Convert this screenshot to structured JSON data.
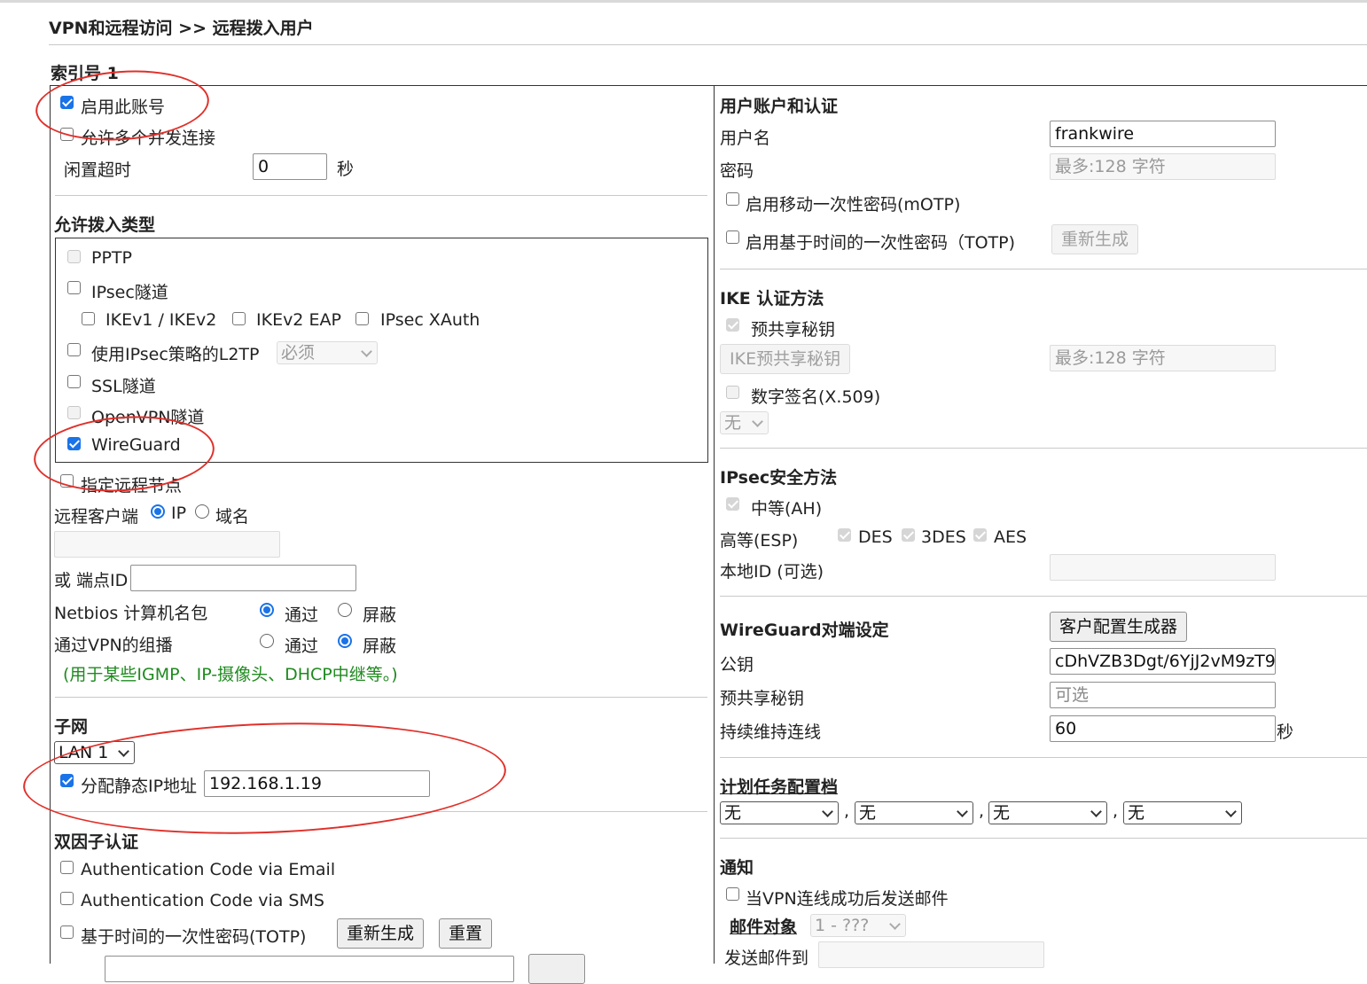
{
  "breadcrumb": "VPN和远程访问 >> 远程拨入用户",
  "index_title": "索引号 1",
  "left": {
    "enable_account": "启用此账号",
    "allow_multi": "允许多个并发连接",
    "idle_timeout_label": "闲置超时",
    "idle_timeout_value": "0",
    "idle_timeout_unit": "秒",
    "dial_in_type_title": "允许拨入类型",
    "pptp": "PPTP",
    "ipsec_tunnel": "IPsec隧道",
    "ikev1_ikev2": "IKEv1 / IKEv2",
    "ikev2_eap": "IKEv2 EAP",
    "ipsec_xauth": "IPsec XAuth",
    "l2tp_label": "使用IPsec策略的L2TP",
    "l2tp_select": "必须",
    "ssl_tunnel": "SSL隧道",
    "openvpn_tunnel": "OpenVPN隧道",
    "wireguard": "WireGuard",
    "specify_remote_node": "指定远程节点",
    "remote_client_label": "远程客户端",
    "remote_client_ip": "IP",
    "remote_client_domain": "域名",
    "or_peer_id": "或 端点ID",
    "netbios_label": "Netbios 计算机名包",
    "multicast_label": "通过VPN的组播",
    "pass": "通过",
    "block": "屏蔽",
    "multicast_note": "(用于某些IGMP、IP-摄像头、DHCP中继等。)",
    "subnet_title": "子网",
    "subnet_select": "LAN 1",
    "assign_static_ip": "分配静态IP地址",
    "static_ip_value": "192.168.1.19",
    "two_factor_title": "双因子认证",
    "auth_email": "Authentication Code via Email",
    "auth_sms": "Authentication Code via SMS",
    "totp": "基于时间的一次性密码(TOTP)",
    "regenerate": "重新生成",
    "reset": "重置"
  },
  "right": {
    "account_title": "用户账户和认证",
    "username_label": "用户名",
    "username_value": "frankwire",
    "password_label": "密码",
    "password_placeholder": "最多:128 字符",
    "motp": "启用移动一次性密码(mOTP)",
    "totp": "启用基于时间的一次性密码（TOTP)",
    "regenerate": "重新生成",
    "ike_title": "IKE 认证方法",
    "psk": "预共享秘钥",
    "ike_psk_button": "IKE预共享秘钥",
    "ike_psk_placeholder": "最多:128 字符",
    "digital_sig": "数字签名(X.509)",
    "digital_sig_select": "无",
    "ipsec_sec_title": "IPsec安全方法",
    "medium_ah": "中等(AH)",
    "high_esp": "高等(ESP)",
    "des": "DES",
    "des3": "3DES",
    "aes": "AES",
    "local_id_label": "本地ID (可选)",
    "wg_title": "WireGuard对端设定",
    "client_config_gen": "客户配置生成器",
    "pubkey_label": "公钥",
    "pubkey_value": "cDhVZB3Dgt/6YjJ2vM9zT9",
    "wg_psk_label": "预共享秘钥",
    "wg_psk_placeholder": "可选",
    "keepalive_label": "持续维持连线",
    "keepalive_value": "60",
    "keepalive_unit": "秒",
    "schedule_title": "计划任务配置档",
    "schedule_values": [
      "无",
      "无",
      "无",
      "无"
    ],
    "comma": ",",
    "notify_title": "通知",
    "notify_email": "当VPN连线成功后发送邮件",
    "mail_target_label": "邮件对象",
    "mail_target_select": "1 - ???",
    "send_mail_to": "发送邮件到"
  },
  "colors": {
    "accent": "#1a73e8",
    "annotation": "#e0302a",
    "note": "#1f8a1f"
  }
}
